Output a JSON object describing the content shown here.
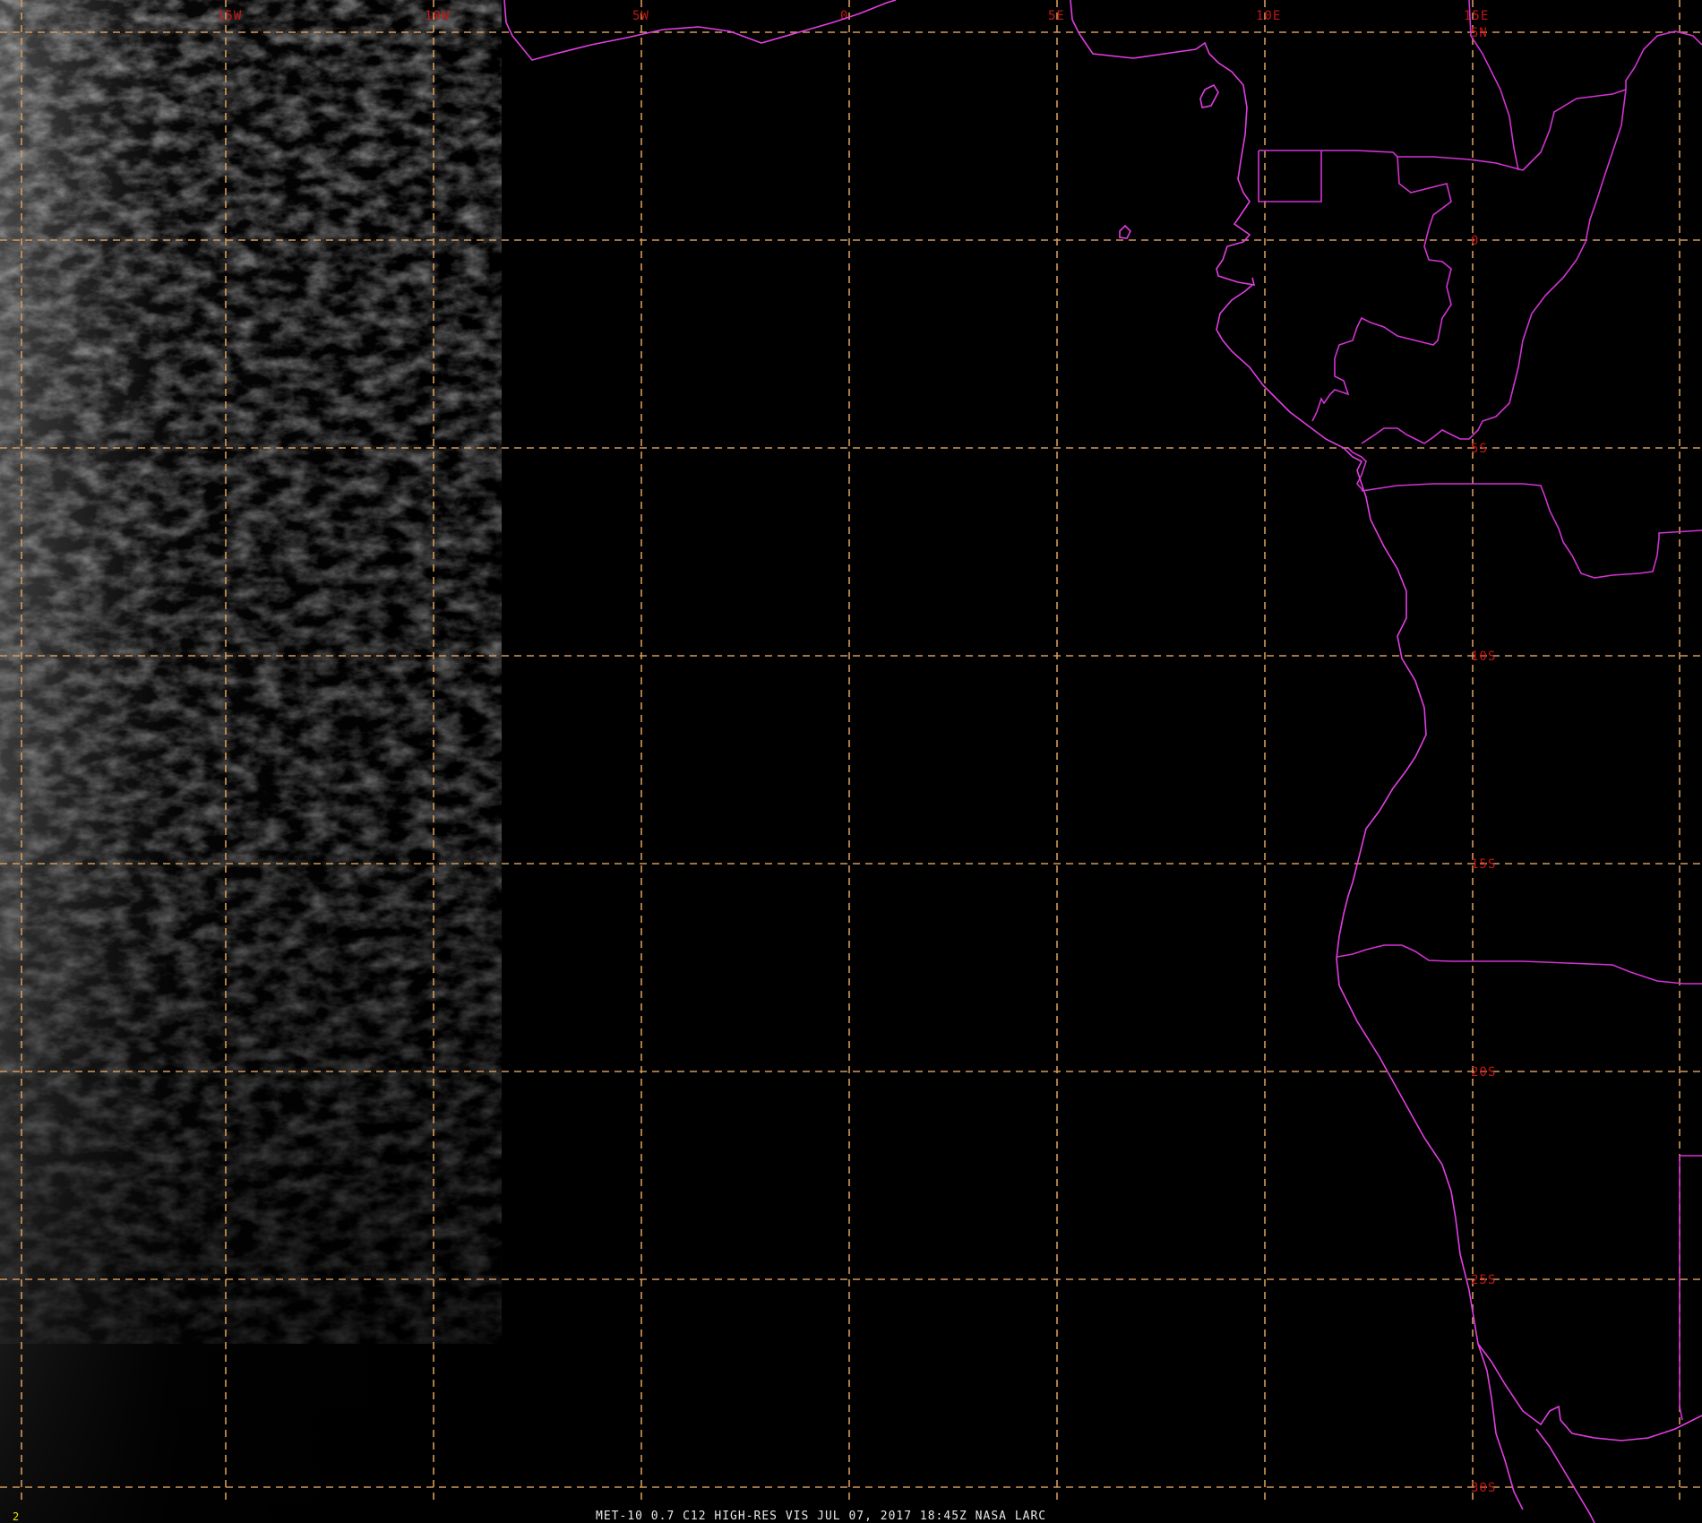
{
  "image": {
    "satellite": "MET-10",
    "channel": "0.7",
    "band": "C12",
    "product": "HIGH-RES VIS",
    "date": "JUL 07, 2017",
    "time": "18:45Z",
    "agency": "NASA LARC",
    "frame_number": "2"
  },
  "footer": {
    "caption": "MET-10 0.7 C12 HIGH-RES VIS   JUL 07, 2017 18:45Z    NASA LARC"
  },
  "grid": {
    "longitudes": [
      {
        "value": -15,
        "label": "15W"
      },
      {
        "value": -10,
        "label": "10W"
      },
      {
        "value": -5,
        "label": "5W"
      },
      {
        "value": 0,
        "label": "0"
      },
      {
        "value": 5,
        "label": "5E"
      },
      {
        "value": 10,
        "label": "10E"
      },
      {
        "value": 15,
        "label": "15E"
      }
    ],
    "latitudes": [
      {
        "value": 5,
        "label": "5N"
      },
      {
        "value": 0,
        "label": "0"
      },
      {
        "value": -5,
        "label": "5S"
      },
      {
        "value": -10,
        "label": "10S"
      },
      {
        "value": -15,
        "label": "15S"
      },
      {
        "value": -20,
        "label": "20S"
      },
      {
        "value": -25,
        "label": "25S"
      },
      {
        "value": -30,
        "label": "30S"
      }
    ]
  },
  "colors": {
    "background": "#000000",
    "gridline": "#d49a5a",
    "grid_label": "#c41616",
    "coastline": "#e23ee2",
    "footer_text": "#e8e8e8",
    "frame_number": "#e6e600",
    "cloud": "#ffffff"
  }
}
